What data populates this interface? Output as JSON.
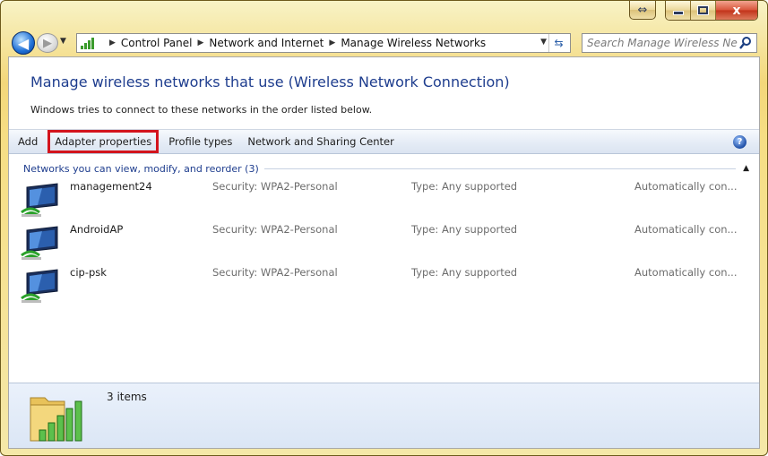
{
  "window": {
    "controls": {
      "minimize": "minimize",
      "maximize": "maximize",
      "close": "x"
    }
  },
  "nav": {
    "breadcrumbs": [
      "Control Panel",
      "Network and Internet",
      "Manage Wireless Networks"
    ],
    "search_placeholder": "Search Manage Wireless Ne..."
  },
  "page": {
    "title": "Manage wireless networks that use (Wireless Network Connection)",
    "description": "Windows tries to connect to these networks in the order listed below."
  },
  "toolbar": {
    "items": [
      "Add",
      "Adapter properties",
      "Profile types",
      "Network and Sharing Center"
    ],
    "highlighted": "Adapter properties"
  },
  "group": {
    "label": "Networks you can view, modify, and reorder (3)"
  },
  "networks": [
    {
      "name": "management24",
      "security": "Security: WPA2-Personal",
      "type": "Type: Any supported",
      "mode": "Automatically con..."
    },
    {
      "name": "AndroidAP",
      "security": "Security: WPA2-Personal",
      "type": "Type: Any supported",
      "mode": "Automatically con..."
    },
    {
      "name": "cip-psk",
      "security": "Security: WPA2-Personal",
      "type": "Type: Any supported",
      "mode": "Automatically con..."
    }
  ],
  "status": {
    "count_text": "3 items"
  },
  "colors": {
    "title_blue": "#1e3d8e",
    "highlight_red": "#d3141d",
    "signal_green": "#3b9b2c"
  }
}
